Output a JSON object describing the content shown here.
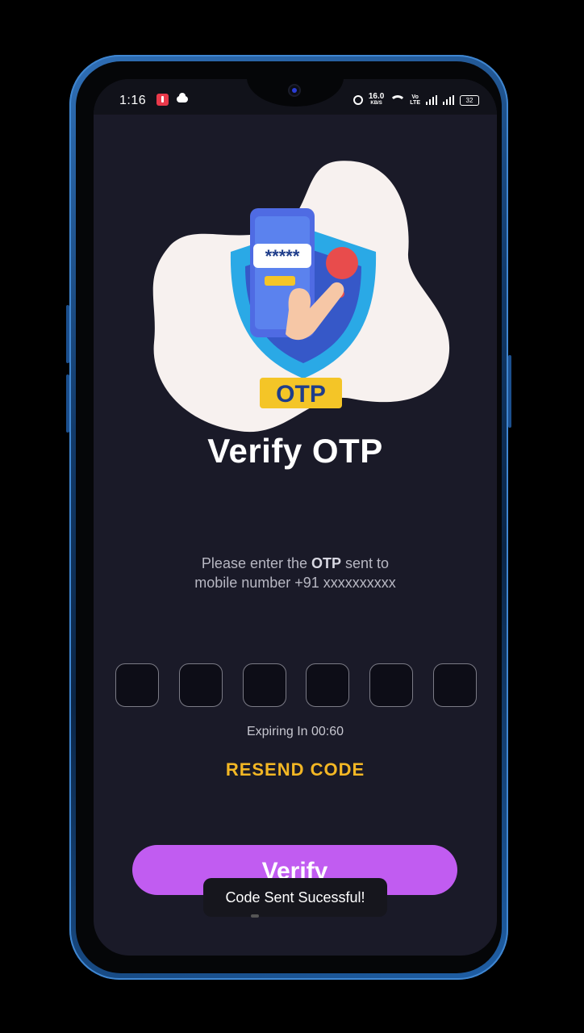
{
  "status_bar": {
    "time": "1:16",
    "net_speed_value": "16.0",
    "net_speed_unit": "KB/S",
    "volte_top": "Vo",
    "volte_bottom": "LTE",
    "battery": "32",
    "icons": [
      "notification-app-icon",
      "cloud-icon",
      "alarm-icon",
      "wifi-icon",
      "signal-icon",
      "battery-icon"
    ]
  },
  "hero": {
    "badge_text": "OTP",
    "masked_code": "*****",
    "colors": {
      "blob": "#f7f1ef",
      "shield": "#2aa9e6",
      "phone": "#4f6be3",
      "badge": "#f4c527",
      "badge_text": "#1f3d8a",
      "dot": "#e84c4c",
      "hand": "#f6c7a6"
    }
  },
  "title": "Verify OTP",
  "instruction": {
    "prefix": "Please enter the ",
    "bold": "OTP",
    "suffix": " sent to",
    "line2": "mobile number +91 xxxxxxxxxx"
  },
  "otp_inputs": [
    "",
    "",
    "",
    "",
    "",
    ""
  ],
  "expiry_text": "Expiring In 00:60",
  "resend_label": "RESEND CODE",
  "verify_label": "Verify",
  "toast": "Code Sent Sucessful!",
  "colors": {
    "background": "#1a1a28",
    "accent_purple": "#c15cf1",
    "accent_yellow": "#f3b724"
  }
}
